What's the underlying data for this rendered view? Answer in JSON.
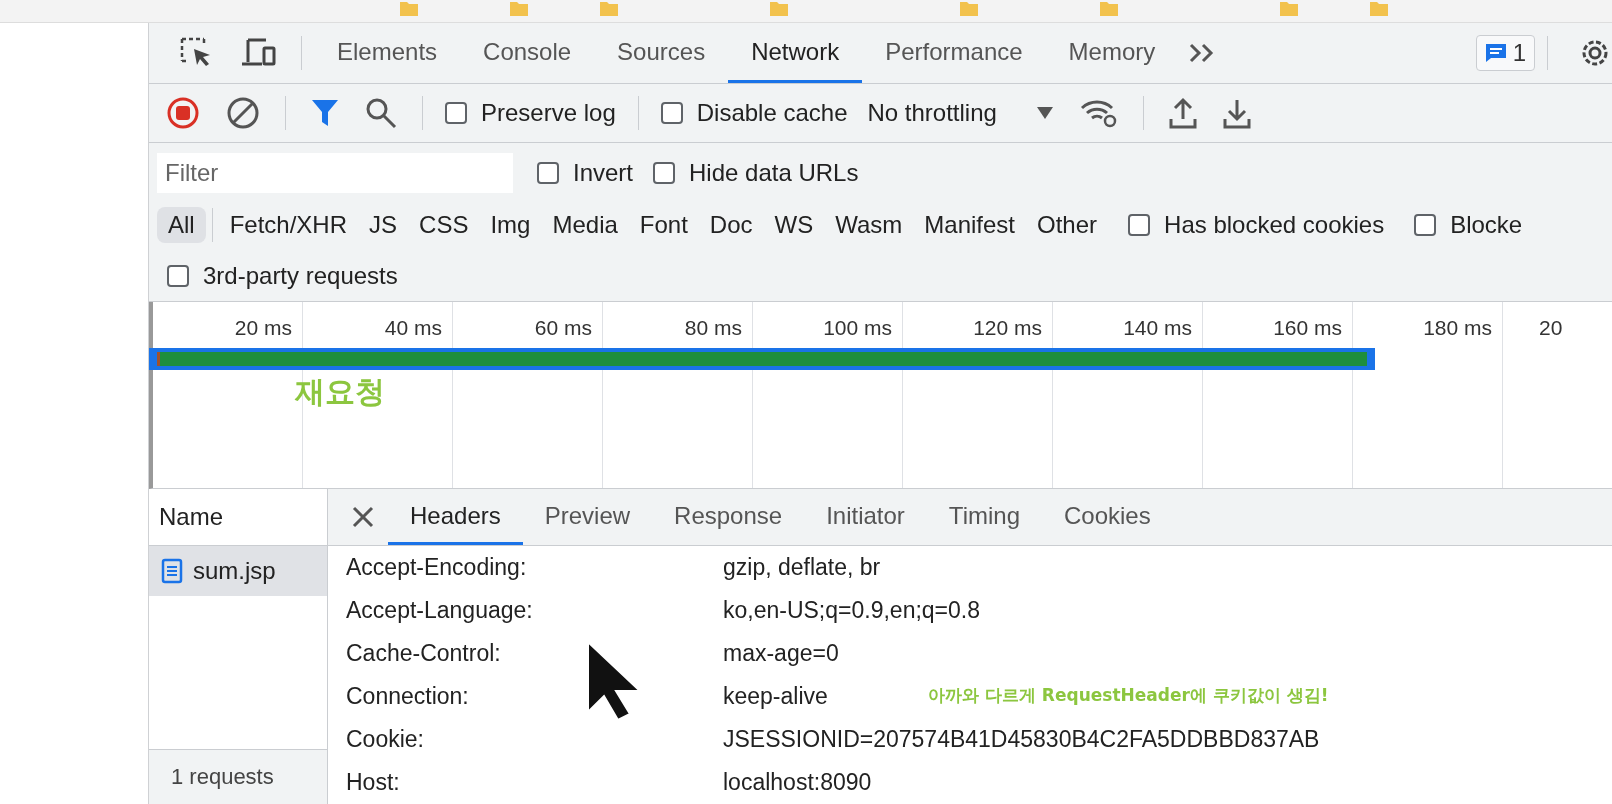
{
  "main_tabs": [
    {
      "label": "Elements",
      "selected": false
    },
    {
      "label": "Console",
      "selected": false
    },
    {
      "label": "Sources",
      "selected": false
    },
    {
      "label": "Network",
      "selected": true
    },
    {
      "label": "Performance",
      "selected": false
    },
    {
      "label": "Memory",
      "selected": false
    }
  ],
  "issues_count": "1",
  "toolbar": {
    "recording": true,
    "checks": [
      {
        "label": "Preserve log",
        "checked": false
      },
      {
        "label": "Disable cache",
        "checked": false
      }
    ],
    "throttling": "No throttling"
  },
  "filter": {
    "placeholder": "Filter",
    "checks": [
      {
        "label": "Invert",
        "checked": false
      },
      {
        "label": "Hide data URLs",
        "checked": false
      }
    ]
  },
  "type_filters": [
    {
      "label": "All",
      "selected": true
    },
    {
      "label": "Fetch/XHR",
      "selected": false
    },
    {
      "label": "JS",
      "selected": false
    },
    {
      "label": "CSS",
      "selected": false
    },
    {
      "label": "Img",
      "selected": false
    },
    {
      "label": "Media",
      "selected": false
    },
    {
      "label": "Font",
      "selected": false
    },
    {
      "label": "Doc",
      "selected": false
    },
    {
      "label": "WS",
      "selected": false
    },
    {
      "label": "Wasm",
      "selected": false
    },
    {
      "label": "Manifest",
      "selected": false
    },
    {
      "label": "Other",
      "selected": false
    }
  ],
  "extra_filters": [
    {
      "label": "Has blocked cookies",
      "checked": false
    },
    {
      "label": "Blocke",
      "checked": false
    }
  ],
  "third_party": {
    "label": "3rd-party requests",
    "checked": false
  },
  "timeline": {
    "ticks": [
      "20 ms",
      "40 ms",
      "60 ms",
      "80 ms",
      "100 ms",
      "120 ms",
      "140 ms",
      "160 ms",
      "180 ms",
      "20"
    ],
    "note": "재요청"
  },
  "requests": {
    "column": "Name",
    "rows": [
      {
        "name": "sum.jsp",
        "selected": true
      }
    ],
    "status": "1 requests"
  },
  "detail_tabs": [
    {
      "label": "Headers",
      "selected": true
    },
    {
      "label": "Preview",
      "selected": false
    },
    {
      "label": "Response",
      "selected": false
    },
    {
      "label": "Initiator",
      "selected": false
    },
    {
      "label": "Timing",
      "selected": false
    },
    {
      "label": "Cookies",
      "selected": false
    }
  ],
  "headers": [
    {
      "name": "Accept-Encoding:",
      "value": "gzip, deflate, br"
    },
    {
      "name": "Accept-Language:",
      "value": "ko,en-US;q=0.9,en;q=0.8"
    },
    {
      "name": "Cache-Control:",
      "value": "max-age=0"
    },
    {
      "name": "Connection:",
      "value": "keep-alive"
    },
    {
      "name": "Cookie:",
      "value": "JSESSIONID=207574B41D45830B4C2FA5DDBBD837AB"
    },
    {
      "name": "Host:",
      "value": "localhost:8090"
    }
  ],
  "header_note": "아까와 다르게 RequestHeader에 쿠키값이 생김!"
}
